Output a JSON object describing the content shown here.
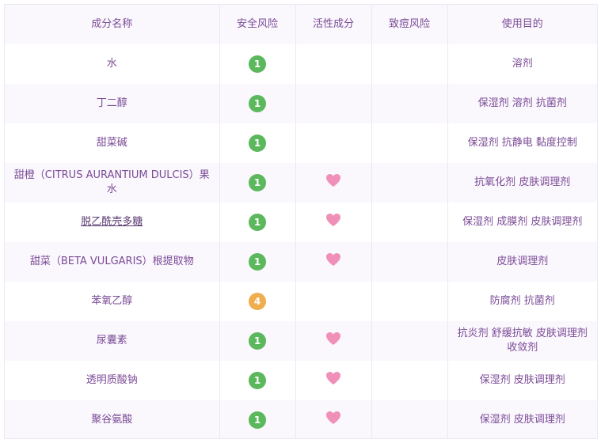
{
  "colors": {
    "text": "#7b4b96",
    "risk_low": "#5cb85c",
    "risk_mid": "#f0ad4e",
    "heart": "#f08fb8",
    "stripe": "#faf7fd"
  },
  "headers": {
    "name": "成分名称",
    "safety": "安全风险",
    "active": "活性成分",
    "acne": "致痘风险",
    "purpose": "使用目的"
  },
  "rows": [
    {
      "name": "水",
      "safety": "1",
      "risk": "low",
      "active": false,
      "acne": "",
      "purpose": "溶剂",
      "link": false
    },
    {
      "name": "丁二醇",
      "safety": "1",
      "risk": "low",
      "active": false,
      "acne": "",
      "purpose": "保湿剂 溶剂 抗菌剂",
      "link": false
    },
    {
      "name": "甜菜碱",
      "safety": "1",
      "risk": "low",
      "active": false,
      "acne": "",
      "purpose": "保湿剂 抗静电 黏度控制",
      "link": false
    },
    {
      "name": "甜橙（CITRUS AURANTIUM DULCIS）果水",
      "safety": "1",
      "risk": "low",
      "active": true,
      "acne": "",
      "purpose": "抗氧化剂 皮肤调理剂",
      "link": false
    },
    {
      "name": "脱乙酰壳多糖",
      "safety": "1",
      "risk": "low",
      "active": true,
      "acne": "",
      "purpose": "保湿剂 成膜剂 皮肤调理剂",
      "link": true
    },
    {
      "name": "甜菜（BETA VULGARIS）根提取物",
      "safety": "1",
      "risk": "low",
      "active": true,
      "acne": "",
      "purpose": "皮肤调理剂",
      "link": false
    },
    {
      "name": "苯氧乙醇",
      "safety": "4",
      "risk": "mid",
      "active": false,
      "acne": "",
      "purpose": "防腐剂 抗菌剂",
      "link": false
    },
    {
      "name": "尿囊素",
      "safety": "1",
      "risk": "low",
      "active": true,
      "acne": "",
      "purpose": "抗炎剂 舒缓抗敏 皮肤调理剂 收敛剂",
      "link": false
    },
    {
      "name": "透明质酸钠",
      "safety": "1",
      "risk": "low",
      "active": true,
      "acne": "",
      "purpose": "保湿剂 皮肤调理剂",
      "link": false
    },
    {
      "name": "聚谷氨酸",
      "safety": "1",
      "risk": "low",
      "active": true,
      "acne": "",
      "purpose": "保湿剂 皮肤调理剂",
      "link": false
    }
  ]
}
